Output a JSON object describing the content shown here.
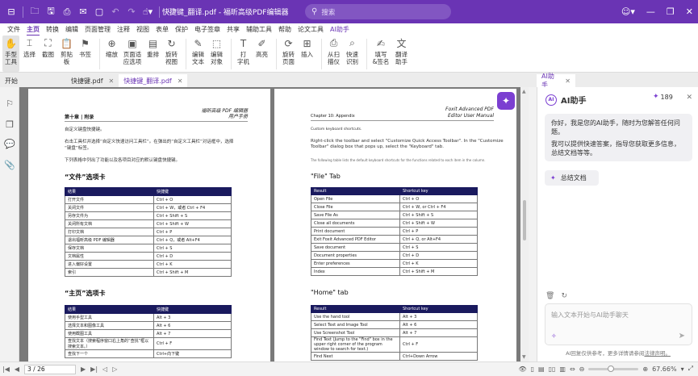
{
  "window": {
    "title": "快捷键_翻译.pdf - 福昕高级PDF编辑器",
    "search_placeholder": "搜索"
  },
  "menus": [
    "文件",
    "主页",
    "转换",
    "编辑",
    "页面管理",
    "注释",
    "视图",
    "表单",
    "保护",
    "电子签章",
    "共享",
    "辅助工具",
    "帮助",
    "论文工具",
    "AI助手"
  ],
  "tools": [
    {
      "name": "hand-tool",
      "label": "手型\n工具",
      "icon": "✋"
    },
    {
      "name": "select-tool",
      "label": "选择",
      "icon": "⌶"
    },
    {
      "name": "screenshot-tool",
      "label": "截图",
      "icon": "⛶"
    },
    {
      "name": "clipboard-tool",
      "label": "剪贴\n板",
      "icon": "📋"
    },
    {
      "name": "bookmark-tool",
      "label": "书签",
      "icon": "⚑"
    },
    {
      "name": "zoom-tool",
      "label": "缩放",
      "icon": "⊕"
    },
    {
      "name": "fit-page-tool",
      "label": "页面适\n应选项",
      "icon": "▣"
    },
    {
      "name": "reflow-tool",
      "label": "重排",
      "icon": "▤"
    },
    {
      "name": "rotate-view-tool",
      "label": "旋转\n视图",
      "icon": "↻"
    },
    {
      "name": "edit-text-tool",
      "label": "编辑\n文本",
      "icon": "✎"
    },
    {
      "name": "edit-object-tool",
      "label": "编辑\n对象",
      "icon": "⬚"
    },
    {
      "name": "typewriter-tool",
      "label": "打\n字机",
      "icon": "T"
    },
    {
      "name": "highlight-tool",
      "label": "高亮",
      "icon": "✐"
    },
    {
      "name": "rotate-page-tool",
      "label": "旋转\n页面",
      "icon": "⟳"
    },
    {
      "name": "insert-tool",
      "label": "插入",
      "icon": "⊞"
    },
    {
      "name": "from-scanner-tool",
      "label": "从扫\n描仪",
      "icon": "⎙"
    },
    {
      "name": "ocr-tool",
      "label": "快速\n识别",
      "icon": "⌕"
    },
    {
      "name": "fill-sign-tool",
      "label": "填写\n&签名",
      "icon": "✍"
    },
    {
      "name": "translate-tool",
      "label": "翻译\n助手",
      "icon": "文"
    }
  ],
  "tabs": {
    "start": "开始",
    "doc1": "快捷键.pdf",
    "doc2": "快捷键_翻译.pdf",
    "ai": "AI助手"
  },
  "page_left": {
    "header_r1": "福昕高级 PDF 编辑器",
    "header_r2": "用户手册",
    "header_l": "第十章 | 附录",
    "p1": "自定义键盘快捷键。",
    "p2a": "右击工具栏并选择“自定义快速访问工具栏”。在弹出的“自定义工具栏”对话框中，选择",
    "p2b": "“键盘”标签。",
    "p3": "下列表格中列出了功能以及各项目对应的默认键盘快捷键。",
    "h_file": "“文件”选项卡",
    "h_home": "“主页”选项卡",
    "file_cols": [
      "结果",
      "快捷键"
    ],
    "file_rows": [
      [
        "打开文件",
        "Ctrl + O"
      ],
      [
        "关闭文件",
        "Ctrl + W，或者 Ctrl + F4"
      ],
      [
        "另存文件为",
        "Ctrl + Shift + S"
      ],
      [
        "关闭所有文档",
        "Ctrl + Shift + W"
      ],
      [
        "打印文档",
        "Ctrl + P"
      ],
      [
        "退出福昕高级 PDF 编辑器",
        "Ctrl + Q，或者 Alt+F4"
      ],
      [
        "保存文档",
        "Ctrl + S"
      ],
      [
        "文档属性",
        "Ctrl + D"
      ],
      [
        "进入偏好设置",
        "Ctrl + K"
      ],
      [
        "索引",
        "Ctrl + Shift + M"
      ]
    ],
    "home_cols": [
      "结果",
      "快捷键"
    ],
    "home_rows": [
      [
        "使用手型工具",
        "Alt + 3"
      ],
      [
        "选择文本和图像工具",
        "Alt + 6"
      ],
      [
        "使用截图工具",
        "Alt + 7"
      ],
      [
        "查找文本（搜索程序窗口右上角的“查找”框以搜索文本。）",
        "Ctrl + F"
      ],
      [
        "查找下一个",
        "Ctrl+向下键"
      ]
    ]
  },
  "page_right": {
    "header_r1": "Foxit Advanced PDF",
    "header_r2": "Editor User Manual",
    "header_l": "Chapter 10: Appendix",
    "p1": "Custom keyboard shortcuts.",
    "p2a": "Right-click the toolbar and select \"Customize Quick Access Toolbar\". In the \"Customize",
    "p2b": "Toolbar\" dialog box that pops up, select the \"Keyboard\" tab.",
    "p3": "The following table lists the default keyboard shortcuts for the functions related to each item in the column.",
    "h_file": "\"File\" Tab",
    "h_home": "\"Home\" tab",
    "file_cols": [
      "Result",
      "Shortcut key"
    ],
    "file_rows": [
      [
        "Open File",
        "Ctrl + O"
      ],
      [
        "Close File",
        "Ctrl + W, or Ctrl + F4"
      ],
      [
        "Save File As",
        "Ctrl + Shift + S"
      ],
      [
        "Close all documents",
        "Ctrl + Shift + W"
      ],
      [
        "Print document",
        "Ctrl + P"
      ],
      [
        "Exit Foxit Advanced PDF Editor",
        "Ctrl + Q, or Alt+F4"
      ],
      [
        "Save document",
        "Ctrl + S"
      ],
      [
        "Document properties",
        "Ctrl + D"
      ],
      [
        "Enter preferences",
        "Ctrl + K"
      ],
      [
        "Index",
        "Ctrl + Shift + M"
      ]
    ],
    "home_cols": [
      "Result",
      "Shortcut key"
    ],
    "home_rows": [
      [
        "Use the hand tool",
        "Alt + 3"
      ],
      [
        "Select Text and Image Tool",
        "Alt + 6"
      ],
      [
        "Use Screenshot Tool",
        "Alt + 7"
      ],
      [
        "Find Text (Jump to the \"Find\" box in the upper right corner of the program window to search for text.)",
        "Ctrl + F"
      ],
      [
        "Find Next",
        "Ctrl+Down Arrow"
      ]
    ]
  },
  "ai": {
    "title": "AI助手",
    "credits": "189",
    "msg1": "你好，我是您的AI助手，随时为您解答任何问题。",
    "msg2": "我可以提供快速答案，指导您获取更多信息，总结文档等等。",
    "summary_btn": "总结文档",
    "input_placeholder": "输入文本开始与AI助手聊天",
    "footer_text": "AI回复仅供参考，更多详情请参阅",
    "footer_link": "法律声明。"
  },
  "status": {
    "page": "3 / 26",
    "zoom": "67.66%"
  }
}
